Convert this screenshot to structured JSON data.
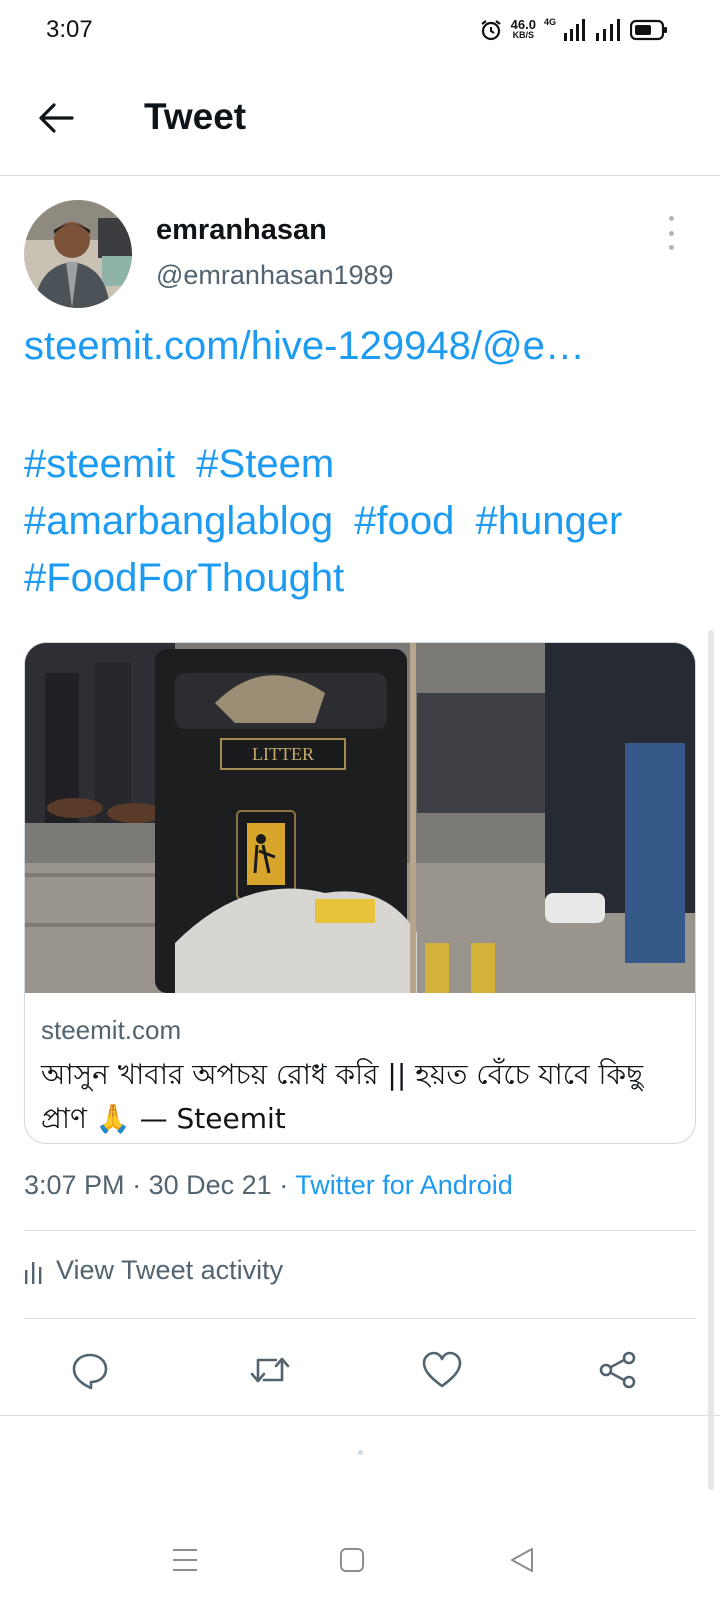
{
  "status_bar": {
    "time": "3:07",
    "net_speed": "46.0",
    "net_speed_unit": "KB/S",
    "network_tag": "4G",
    "icons": [
      "alarm-icon",
      "signal-4g-icon",
      "signal-icon",
      "battery-icon"
    ]
  },
  "header": {
    "title": "Tweet",
    "back_icon": "arrow-left-icon"
  },
  "author": {
    "name": "emranhasan",
    "handle": "@emranhasan1989"
  },
  "tweet": {
    "link_text": "steemit.com/hive-129948/@e…",
    "hashtags": [
      "#steemit",
      "#Steem",
      "#amarbanglablog",
      "#food",
      "#hunger",
      "#FoodForThought"
    ]
  },
  "card": {
    "image_sign_text": "LITTER",
    "domain": "steemit.com",
    "title": "আসুন খাবার অপচয় রোধ করি || হয়ত বেঁচে যাবে কিছু প্রাণ 🙏 — Steemit"
  },
  "meta": {
    "time": "3:07 PM",
    "separator": "·",
    "date": "30 Dec 21",
    "source": "Twitter for Android"
  },
  "activity": {
    "label": "View Tweet activity"
  },
  "actions": [
    "reply-icon",
    "retweet-icon",
    "like-icon",
    "share-icon"
  ],
  "nav_bar": [
    "menu-icon",
    "home-icon",
    "back-icon"
  ],
  "colors": {
    "accent": "#1d9bf0",
    "secondary_text": "#536471",
    "primary_text": "#0f1419",
    "divider": "#dcdfe2"
  }
}
